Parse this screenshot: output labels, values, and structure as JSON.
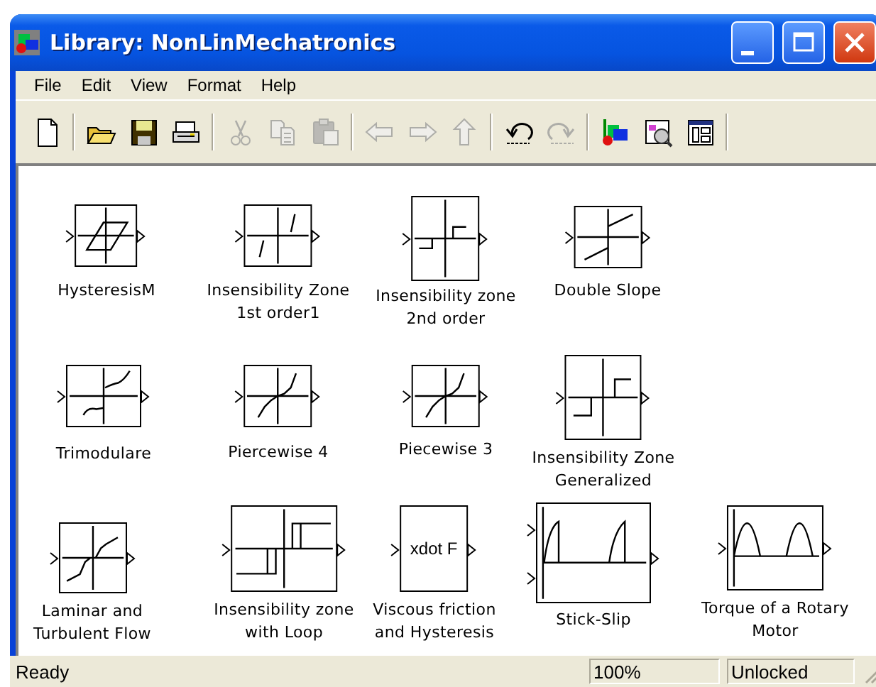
{
  "window": {
    "title": "Library: NonLinMechatronics"
  },
  "menu": [
    {
      "label": "File"
    },
    {
      "label": "Edit"
    },
    {
      "label": "View"
    },
    {
      "label": "Format"
    },
    {
      "label": "Help"
    }
  ],
  "toolbar": [
    [
      {
        "kind": "new",
        "disabled": false
      }
    ],
    [
      {
        "kind": "open",
        "disabled": false
      },
      {
        "kind": "save",
        "disabled": false
      },
      {
        "kind": "print",
        "disabled": false
      }
    ],
    [
      {
        "kind": "cut",
        "disabled": true
      },
      {
        "kind": "copy",
        "disabled": true
      },
      {
        "kind": "paste",
        "disabled": true
      }
    ],
    [
      {
        "kind": "back",
        "disabled": true
      },
      {
        "kind": "forward",
        "disabled": true
      },
      {
        "kind": "up",
        "disabled": true
      }
    ],
    [
      {
        "kind": "undo",
        "disabled": false
      },
      {
        "kind": "redo",
        "disabled": true
      }
    ],
    [
      {
        "kind": "library",
        "disabled": false
      },
      {
        "kind": "browser",
        "disabled": false
      },
      {
        "kind": "debugger",
        "disabled": false
      }
    ]
  ],
  "blocks": [
    {
      "kind": "hysteresis",
      "label": [
        "HysteresisM"
      ]
    },
    {
      "kind": "deadzone",
      "label": [
        "Insensibility Zone",
        "1st order1"
      ]
    },
    {
      "kind": "relay",
      "label": [
        "Insensibility zone",
        "2nd order"
      ]
    },
    {
      "kind": "double-slope",
      "label": [
        "Double Slope"
      ]
    },
    {
      "kind": "trimodular",
      "label": [
        "Trimodulare"
      ]
    },
    {
      "kind": "piecewise",
      "label": [
        "Piercewise 4"
      ]
    },
    {
      "kind": "piecewise",
      "label": [
        "Piecewise 3"
      ]
    },
    {
      "kind": "relay-generalized",
      "label": [
        "Insensibility Zone",
        "Generalized"
      ]
    },
    {
      "kind": "laminar",
      "label": [
        "Laminar and",
        "Turbulent Flow"
      ]
    },
    {
      "kind": "relay-loop",
      "label": [
        "Insensibility zone",
        "with Loop"
      ]
    },
    {
      "kind": "text",
      "text": "xdot  F",
      "label": [
        "Viscous friction",
        "and Hysteresis"
      ]
    },
    {
      "kind": "stick-slip",
      "label": [
        "Stick-Slip"
      ]
    },
    {
      "kind": "rectified",
      "label": [
        "Torque of a Rotary",
        "Motor"
      ]
    }
  ],
  "status_bar": {
    "message": "Ready",
    "zoom": "100%",
    "lock": "Unlocked"
  }
}
